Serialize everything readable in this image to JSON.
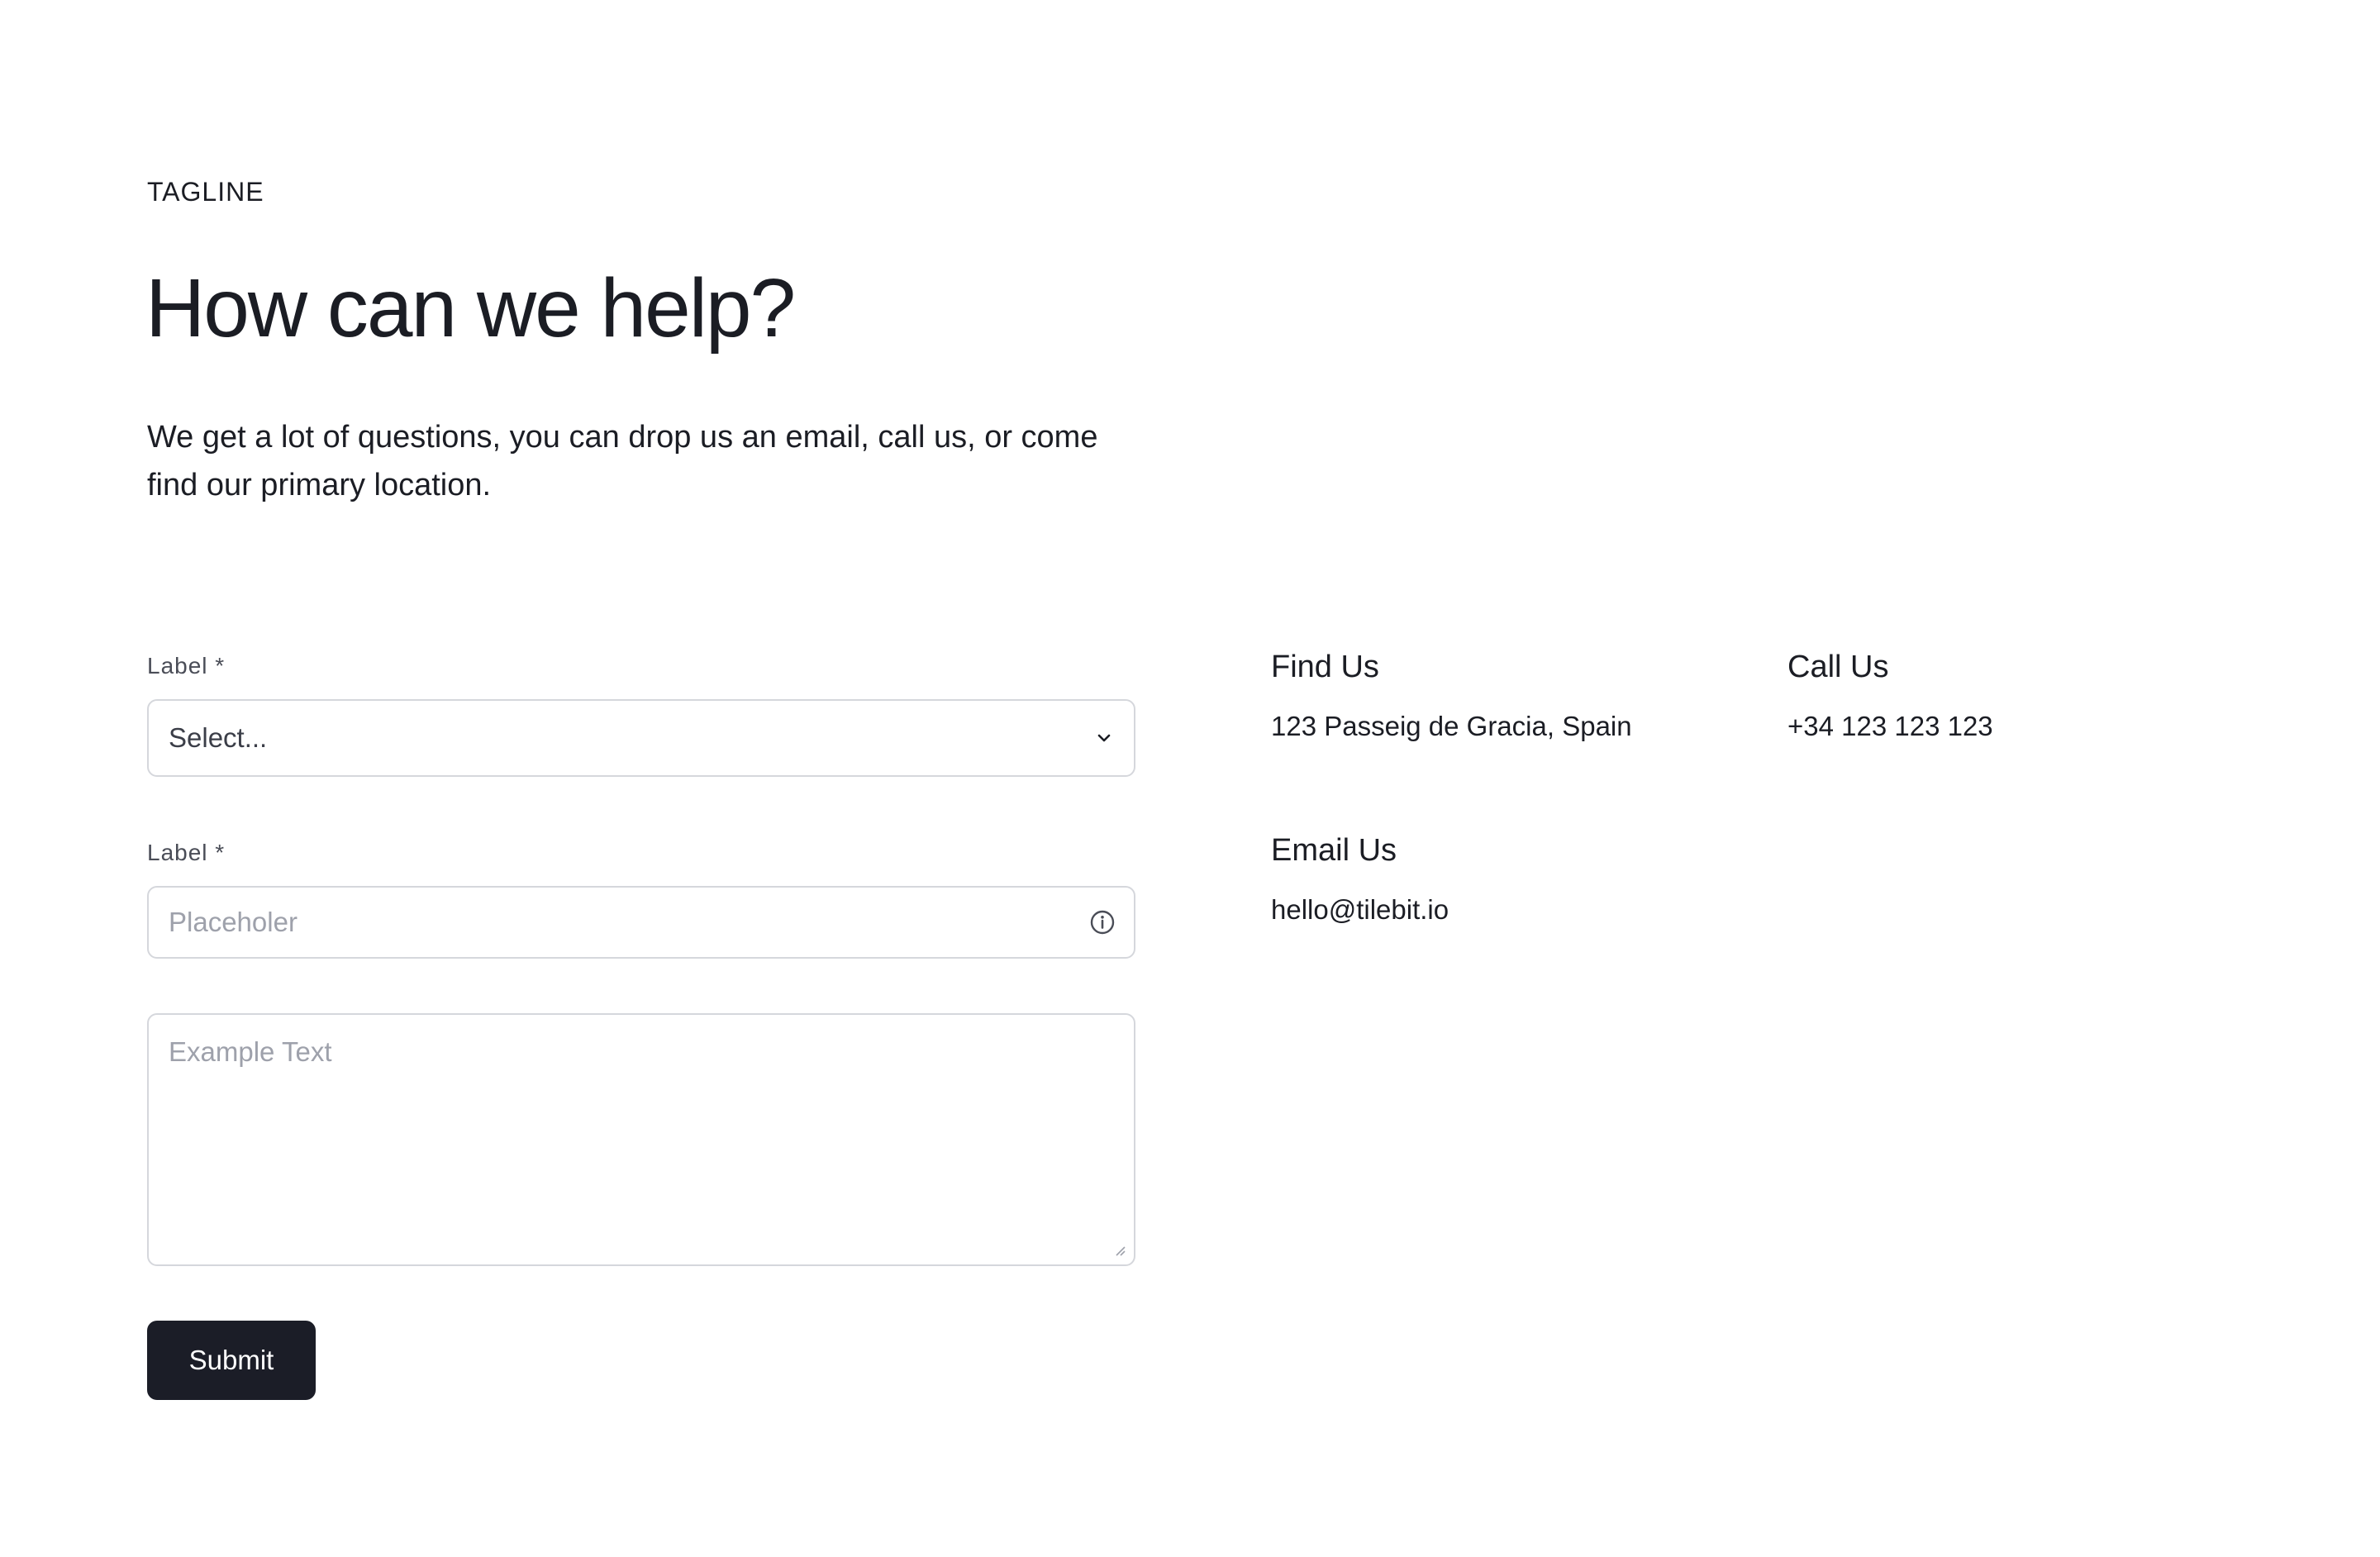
{
  "hero": {
    "tagline": "TAGLINE",
    "title": "How can we help?",
    "lead": "We get a lot of questions, you can drop us an email, call us, or come find our primary location."
  },
  "form": {
    "select_label": "Label *",
    "select_value": "Select...",
    "input_label": "Label *",
    "input_placeholder": "Placeholer",
    "textarea_placeholder": "Example Text",
    "submit_label": "Submit"
  },
  "contact": {
    "find": {
      "heading": "Find Us",
      "value": "123 Passeig de Gracia, Spain"
    },
    "call": {
      "heading": "Call Us",
      "value": "+34 123 123 123"
    },
    "email": {
      "heading": "Email Us",
      "value": "hello@tilebit.io"
    }
  },
  "icons": {
    "select_chevron": "chevron-down-icon",
    "input_info": "info-icon",
    "textarea_resize": "resize-handle-icon"
  },
  "colors": {
    "text": "#1b1d24",
    "border": "#d5d7dc",
    "placeholder": "#9ea1ab",
    "button_bg": "#1b1d27",
    "button_text": "#ffffff"
  }
}
